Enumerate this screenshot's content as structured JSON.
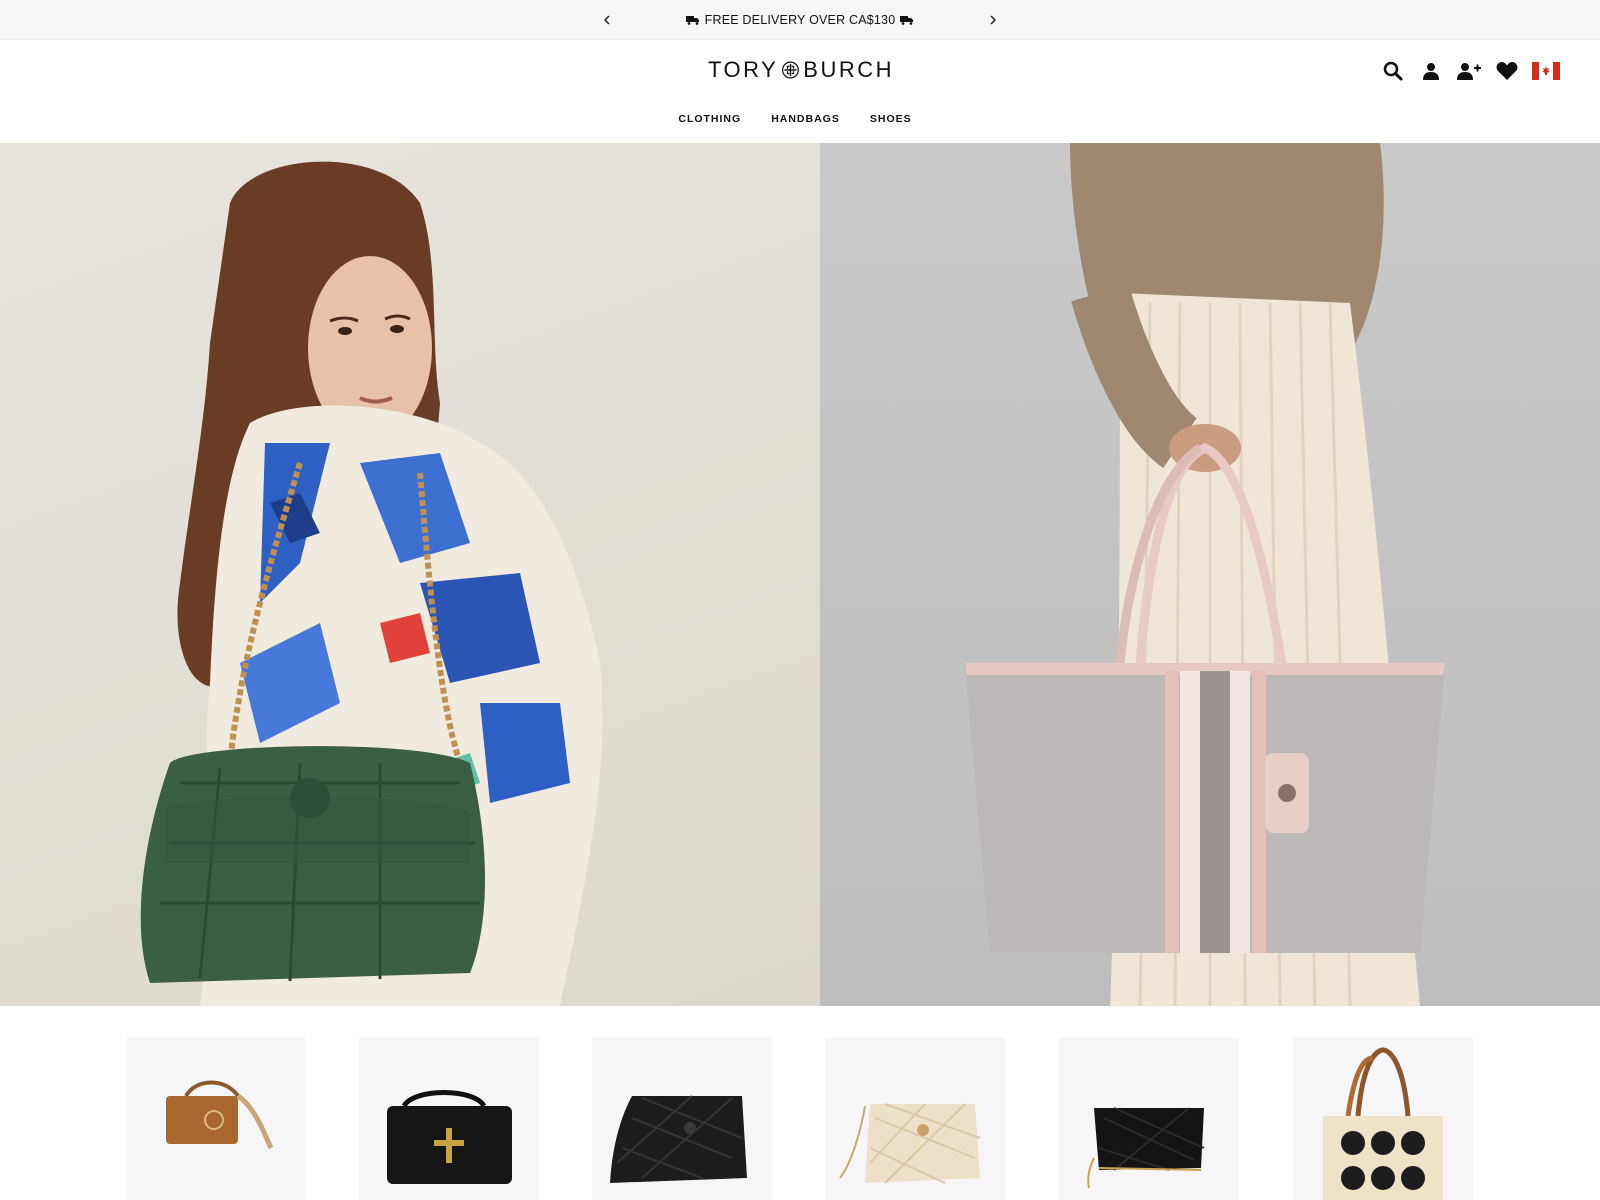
{
  "promo": {
    "message": "FREE DELIVERY OVER CA$130",
    "prev_icon": "chevron-left-icon",
    "next_icon": "chevron-right-icon"
  },
  "header": {
    "logo_left": "TORY",
    "logo_right": "BURCH",
    "icons": [
      "search-icon",
      "account-icon",
      "register-icon",
      "wishlist-icon",
      "canada-flag-icon"
    ]
  },
  "nav": {
    "items": [
      {
        "label": "CLOTHING"
      },
      {
        "label": "HANDBAGS"
      },
      {
        "label": "SHOES"
      }
    ]
  },
  "colors": {
    "promo_bg": "#f6f6f7",
    "card_bg": "#f6f6f8",
    "flag_red": "#d52b1e"
  }
}
